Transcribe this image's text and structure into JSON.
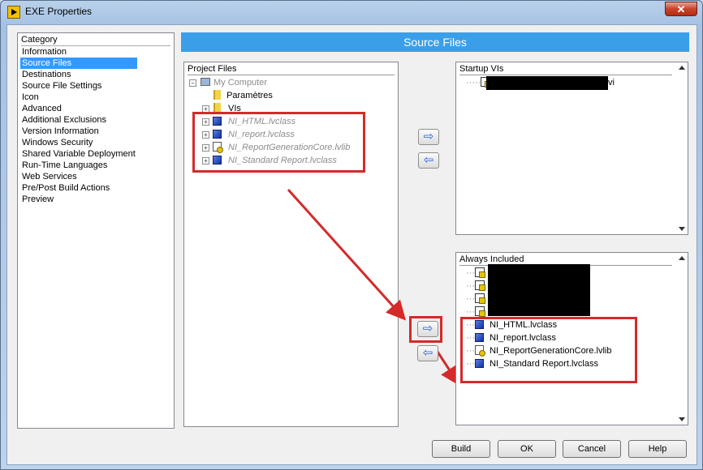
{
  "window": {
    "title": "EXE Properties",
    "close_icon": "close-icon"
  },
  "category": {
    "header": "Category",
    "items": [
      "Information",
      "Source Files",
      "Destinations",
      "Source File Settings",
      "Icon",
      "Advanced",
      "Additional Exclusions",
      "Version Information",
      "Windows Security",
      "Shared Variable Deployment",
      "Run-Time Languages",
      "Web Services",
      "Pre/Post Build Actions",
      "Preview"
    ],
    "selected": "Source Files"
  },
  "banner": {
    "title": "Source Files",
    "color": "#3a9fe8"
  },
  "project_files": {
    "header": "Project Files",
    "root": "My Computer",
    "items": [
      "Paramètres",
      "VIs",
      "NI_HTML.lvclass",
      "NI_report.lvclass",
      "NI_ReportGenerationCore.lvlib",
      "NI_Standard Report.lvclass"
    ]
  },
  "startup_vis": {
    "header": "Startup VIs",
    "item_suffix": "vi"
  },
  "always_included": {
    "header": "Always Included",
    "items": [
      "NI_HTML.lvclass",
      "NI_report.lvclass",
      "NI_ReportGenerationCore.lvlib",
      "NI_Standard Report.lvclass"
    ]
  },
  "transfer": {
    "add_icon": "arrow-right-icon",
    "remove_icon": "arrow-left-icon",
    "add_glyph": "⇨",
    "remove_glyph": "⇦"
  },
  "buttons": {
    "build": "Build",
    "ok": "OK",
    "cancel": "Cancel",
    "help": "Help"
  },
  "colors": {
    "highlight": "#d42a2a",
    "selection": "#3399ff"
  }
}
